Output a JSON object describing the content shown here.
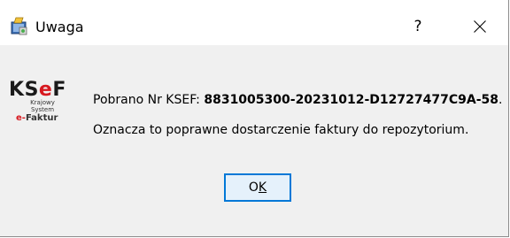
{
  "window": {
    "title": "Uwaga",
    "help_label": "?",
    "app_icon": "installer-icon",
    "close_icon": "close-icon"
  },
  "logo": {
    "main_k": "K",
    "main_s": "S",
    "main_e": "e",
    "main_f": "F",
    "sub_line1": "Krajowy",
    "sub_line2": "System",
    "bottom_red": "e-",
    "bottom_rest": "Faktur"
  },
  "message": {
    "line1_prefix": "Pobrano Nr KSEF: ",
    "ksef_number": "8831005300-20231012-D12727477C9A-58",
    "line1_suffix": ".",
    "line2": "Oznacza to poprawne dostarczenie faktury do repozytorium."
  },
  "buttons": {
    "ok_first": "O",
    "ok_underlined": "K"
  },
  "colors": {
    "accent": "#0078d7",
    "button_bg": "#e5f1fb",
    "dialog_bg": "#f0f0f0",
    "logo_red": "#d71920"
  }
}
